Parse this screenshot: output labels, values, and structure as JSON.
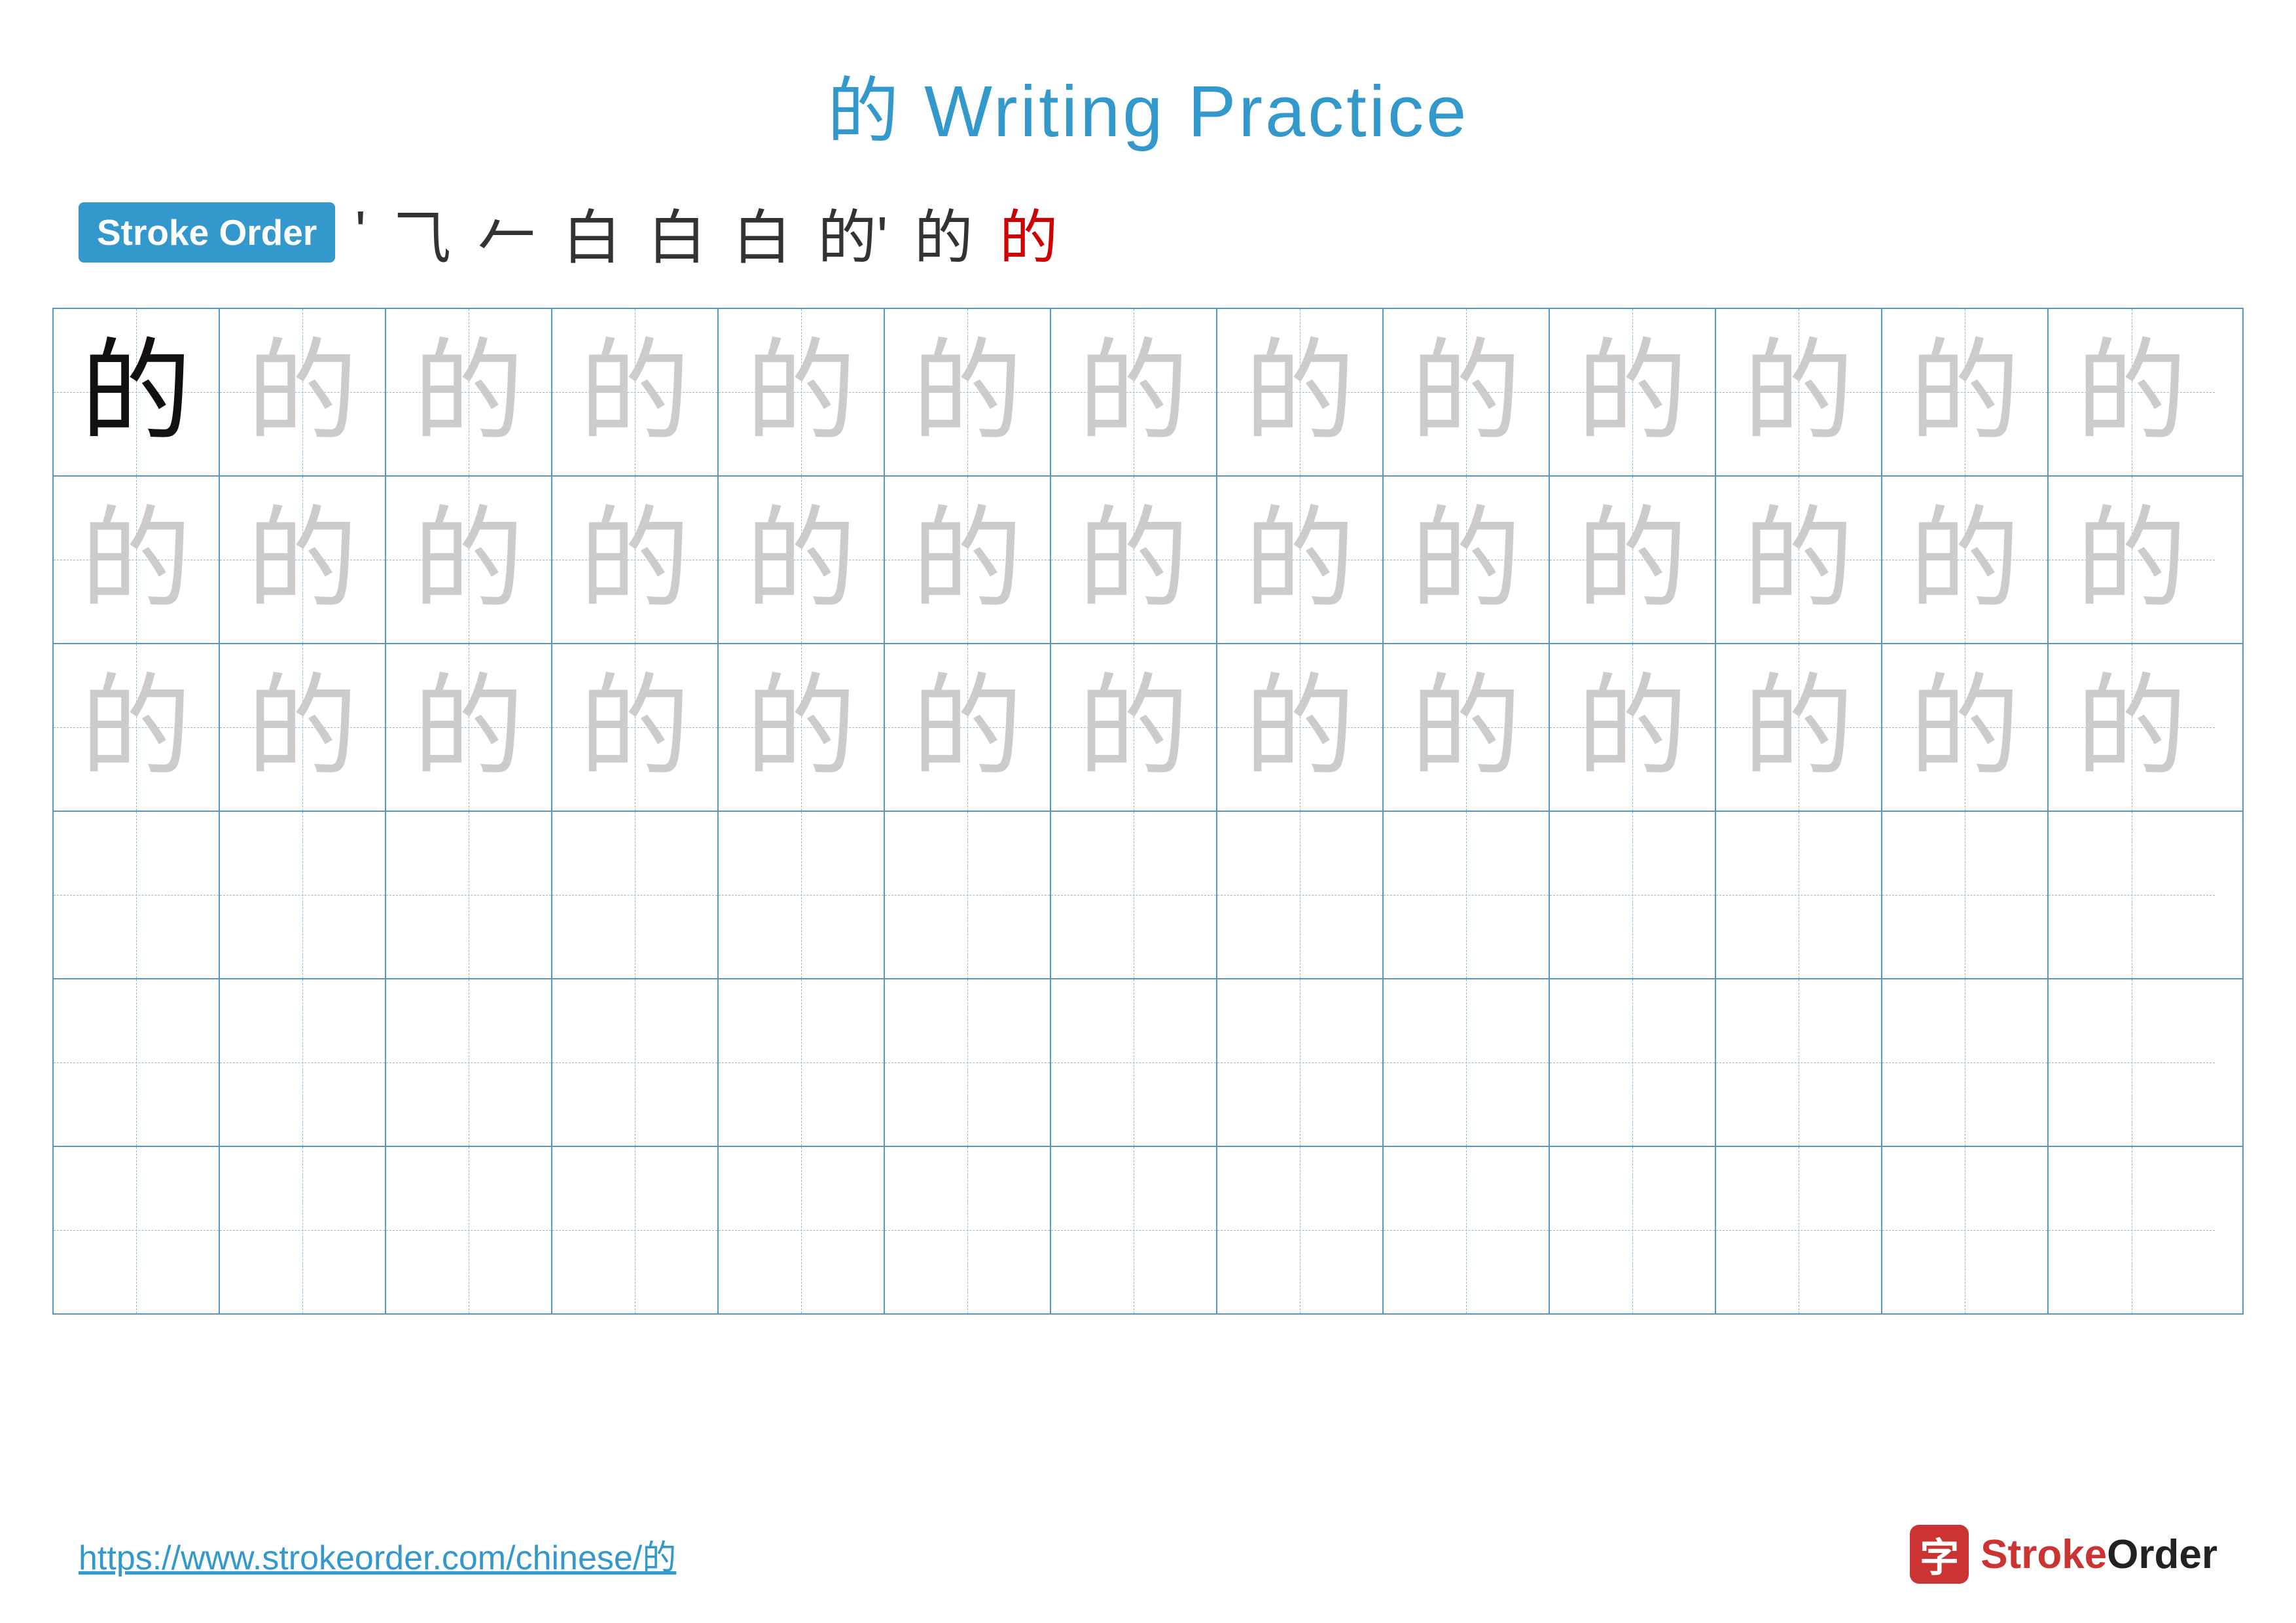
{
  "page": {
    "title": "的 Writing Practice",
    "character": "的",
    "stroke_order_label": "Stroke Order",
    "stroke_sequence": [
      "'",
      "⺄",
      "𠃌",
      "白",
      "白",
      "白",
      "的'",
      "的",
      "的"
    ],
    "url": "https://www.strokeorder.com/chinese/的",
    "logo_text": "StrokeOrder",
    "rows": 6,
    "cols": 13,
    "row_descriptions": [
      "solid_then_ghost",
      "all_ghost",
      "all_ghost",
      "empty",
      "empty",
      "empty"
    ]
  }
}
